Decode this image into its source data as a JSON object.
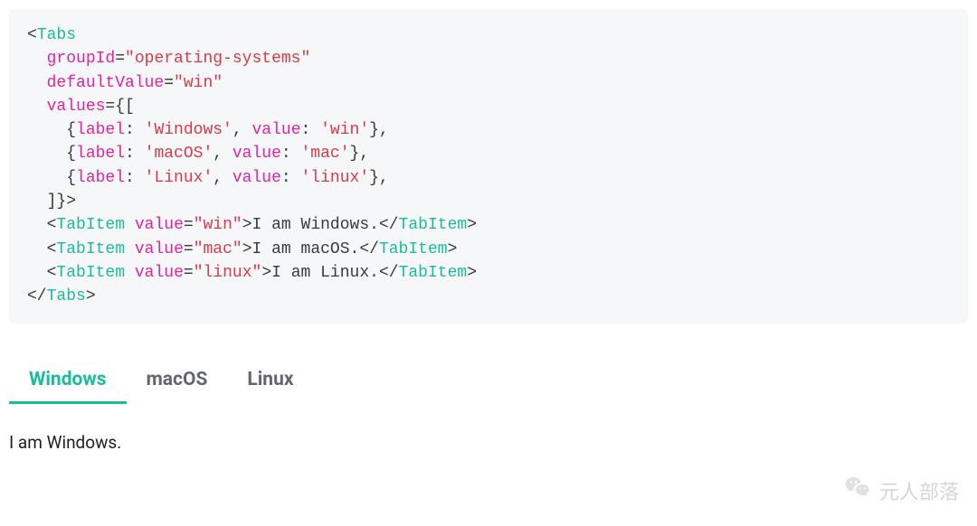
{
  "code": {
    "tabs_tag": "Tabs",
    "attr_groupId": "groupId",
    "val_groupId": "\"operating-systems\"",
    "attr_defaultValue": "defaultValue",
    "val_defaultValue": "\"win\"",
    "attr_values": "values",
    "values_open": "={[",
    "item1_open": "    {",
    "label_key": "label",
    "item1_label": " 'Windows'",
    "value_key": "value",
    "item1_value": " 'win'",
    "item_close": "},",
    "item2_label": " 'macOS'",
    "item2_value": " 'mac'",
    "item3_label": " 'Linux'",
    "item3_value": " 'linux'",
    "values_close": "  ]}",
    "tabitem_tag": "TabItem",
    "tabitem_value_attr": "value",
    "tabitem1_value": "\"win\"",
    "tabitem1_text": "I am Windows.",
    "tabitem2_value": "\"mac\"",
    "tabitem2_text": "I am macOS.",
    "tabitem3_value": "\"linux\"",
    "tabitem3_text": "I am Linux."
  },
  "tabs": {
    "items": [
      {
        "label": "Windows"
      },
      {
        "label": "macOS"
      },
      {
        "label": "Linux"
      }
    ],
    "active_index": 0,
    "content": "I am Windows."
  },
  "watermark": {
    "text": "元人部落"
  }
}
